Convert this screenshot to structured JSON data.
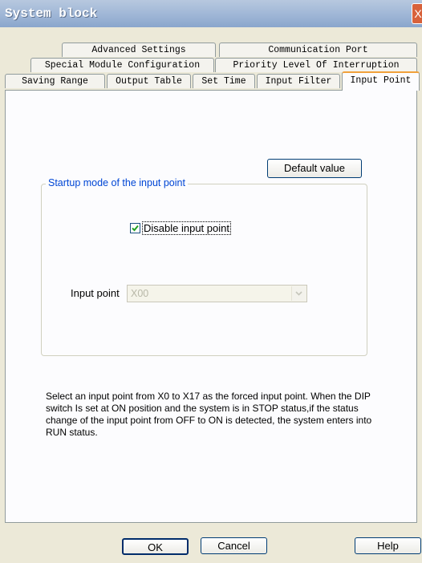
{
  "window": {
    "title": "System block",
    "close_label": "X"
  },
  "tabs": {
    "row1": [
      "Advanced Settings",
      "Communication Port"
    ],
    "row2": [
      "Special Module Configuration",
      "Priority Level Of Interruption"
    ],
    "row3": [
      "Saving Range",
      "Output Table",
      "Set Time",
      "Input Filter",
      "Input Point"
    ],
    "active": "Input Point"
  },
  "panel": {
    "default_button": "Default value",
    "group_title": "Startup mode of the input point",
    "checkbox": {
      "label": "Disable input point",
      "checked": true
    },
    "input_point": {
      "label": "Input point",
      "value": "X00",
      "disabled": true
    },
    "description": "Select an input point from X0 to X17 as the forced input point. When the DIP switch Is set at ON position and the system is in STOP status,if the status change of the input point from OFF to ON is detected, the system enters into RUN status."
  },
  "footer": {
    "ok": "OK",
    "cancel": "Cancel",
    "help": "Help"
  }
}
